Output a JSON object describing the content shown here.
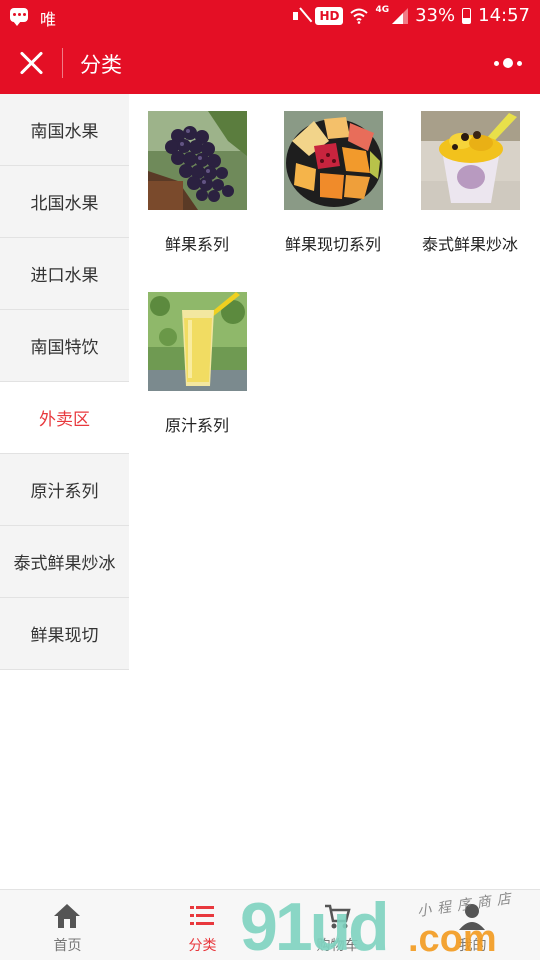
{
  "status_bar": {
    "carrier": "唯",
    "hd_badge": "HD",
    "network": "4G",
    "battery": "33%",
    "time": "14:57"
  },
  "nav": {
    "title": "分类"
  },
  "sidebar": {
    "items": [
      {
        "label": "南国水果",
        "active": false
      },
      {
        "label": "北国水果",
        "active": false
      },
      {
        "label": "进口水果",
        "active": false
      },
      {
        "label": "南国特饮",
        "active": false
      },
      {
        "label": "外卖区",
        "active": true
      },
      {
        "label": "原汁系列",
        "active": false
      },
      {
        "label": "泰式鲜果炒冰",
        "active": false
      },
      {
        "label": "鲜果现切",
        "active": false
      }
    ]
  },
  "products": [
    {
      "label": "鲜果系列",
      "image": "grapes-photo"
    },
    {
      "label": "鲜果现切系列",
      "image": "cut-fruit-platter-photo"
    },
    {
      "label": "泰式鲜果炒冰",
      "image": "mango-ice-cup-photo"
    },
    {
      "label": "原汁系列",
      "image": "juice-glass-photo"
    }
  ],
  "tabbar": {
    "tabs": [
      {
        "label": "首页",
        "icon": "home-icon",
        "active": false
      },
      {
        "label": "分类",
        "icon": "category-list-icon",
        "active": true
      },
      {
        "label": "购物车",
        "icon": "cart-icon",
        "active": false
      },
      {
        "label": "我的",
        "icon": "user-icon",
        "active": false
      }
    ]
  },
  "watermark": {
    "brand": "91ud",
    "domain": ".com",
    "tagline": "小程序商店"
  },
  "colors": {
    "brand_red": "#e40f25",
    "active_text": "#e8383d",
    "sidebar_bg": "#f4f4f4",
    "tab_inactive": "#777777"
  }
}
